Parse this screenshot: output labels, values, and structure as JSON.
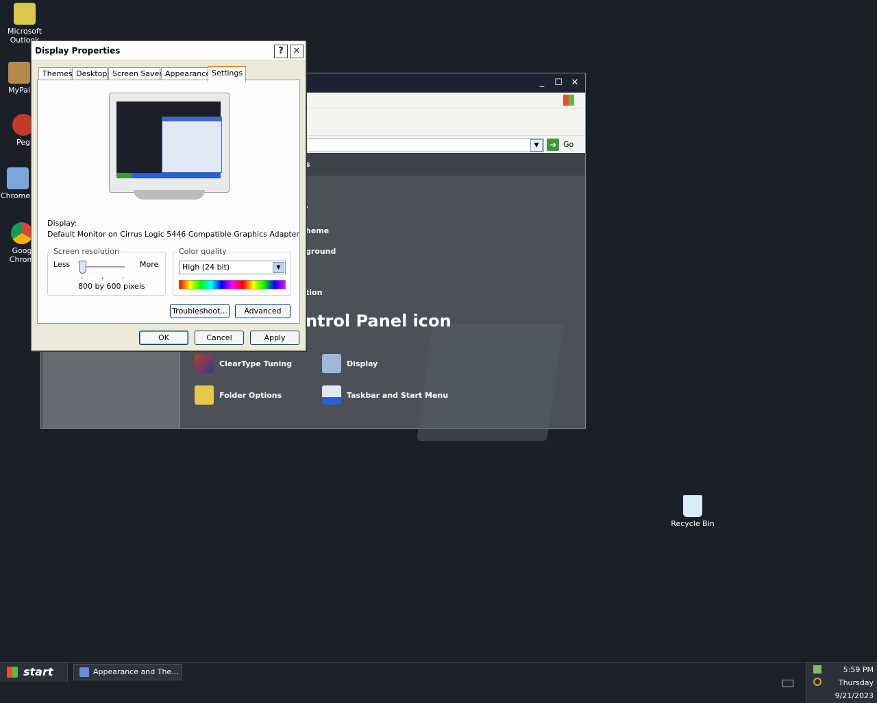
{
  "desktop": {
    "icons": [
      {
        "label": "Microsoft\nOutlook"
      },
      {
        "label": "MyPal"
      },
      {
        "label": "Peg"
      },
      {
        "label": "ChromeS"
      },
      {
        "label": "Goog\nChrom"
      }
    ],
    "recycle_bin": "Recycle Bin"
  },
  "control_panel": {
    "address_go": "Go",
    "partial_links": [
      "s",
      ".",
      "heme",
      "ground",
      "tion"
    ],
    "heading": "ntrol Panel icon",
    "icons": [
      {
        "label": "ClearType Tuning",
        "icon": "cleartype-icon"
      },
      {
        "label": "Display",
        "icon": "display-icon"
      },
      {
        "label": "Folder Options",
        "icon": "folder-options-icon"
      },
      {
        "label": "Taskbar and Start Menu",
        "icon": "taskbar-icon"
      }
    ]
  },
  "dialog": {
    "title": "Display Properties",
    "help_button": "?",
    "close_button": "✕",
    "tabs": [
      "Themes",
      "Desktop",
      "Screen Saver",
      "Appearance",
      "Settings"
    ],
    "active_tab": "Settings",
    "display_label": "Display:",
    "display_value": "Default Monitor on Cirrus Logic 5446 Compatible Graphics Adapter",
    "resolution": {
      "group_title": "Screen resolution",
      "less": "Less",
      "more": "More",
      "value": "800 by 600 pixels",
      "level": 0
    },
    "color_quality": {
      "group_title": "Color quality",
      "selected": "High (24 bit)"
    },
    "buttons": {
      "troubleshoot": "Troubleshoot...",
      "advanced": "Advanced",
      "ok": "OK",
      "cancel": "Cancel",
      "apply": "Apply"
    }
  },
  "taskbar": {
    "start": "start",
    "items": [
      "Appearance and The..."
    ],
    "clock_time": "5:59 PM",
    "clock_day": "Thursday",
    "clock_date": "9/21/2023"
  },
  "colors": {
    "desktop": "#1b1f27",
    "dialog_face": "#ece9d8",
    "active_tab_accent": "#e68b2c"
  }
}
